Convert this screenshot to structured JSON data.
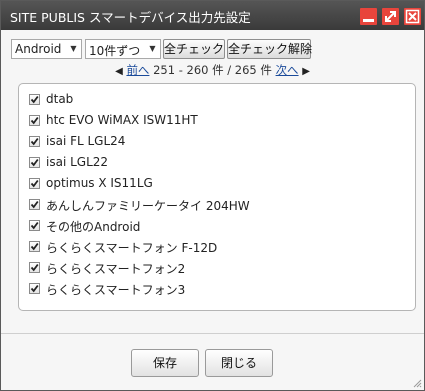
{
  "window": {
    "title": "SITE PUBLIS スマートデバイス出力先設定"
  },
  "icons": {
    "minimize": "minimize-icon",
    "maximize": "maximize-icon",
    "close": "close-icon",
    "checkbox": "check-icon"
  },
  "colors": {
    "titlebar": "#3f3f3f",
    "window_button": "#e8453c",
    "link": "#1a4a9a"
  },
  "toolbar": {
    "os_select": "Android",
    "count_select": "10件ずつ",
    "check_all": "全チェック",
    "uncheck_all": "全チェック解除"
  },
  "pager": {
    "prev": "前へ",
    "range": "251 - 260 件 / 265 件",
    "next": "次へ"
  },
  "devices": [
    {
      "label": "dtab",
      "checked": true
    },
    {
      "label": "htc EVO WiMAX ISW11HT",
      "checked": true
    },
    {
      "label": "isai FL LGL24",
      "checked": true
    },
    {
      "label": "isai LGL22",
      "checked": true
    },
    {
      "label": "optimus X IS11LG",
      "checked": true
    },
    {
      "label": "あんしんファミリーケータイ 204HW",
      "checked": true
    },
    {
      "label": "その他のAndroid",
      "checked": true
    },
    {
      "label": "らくらくスマートフォン F-12D",
      "checked": true
    },
    {
      "label": "らくらくスマートフォン2",
      "checked": true
    },
    {
      "label": "らくらくスマートフォン3",
      "checked": true
    }
  ],
  "footer": {
    "save": "保存",
    "close": "閉じる"
  }
}
